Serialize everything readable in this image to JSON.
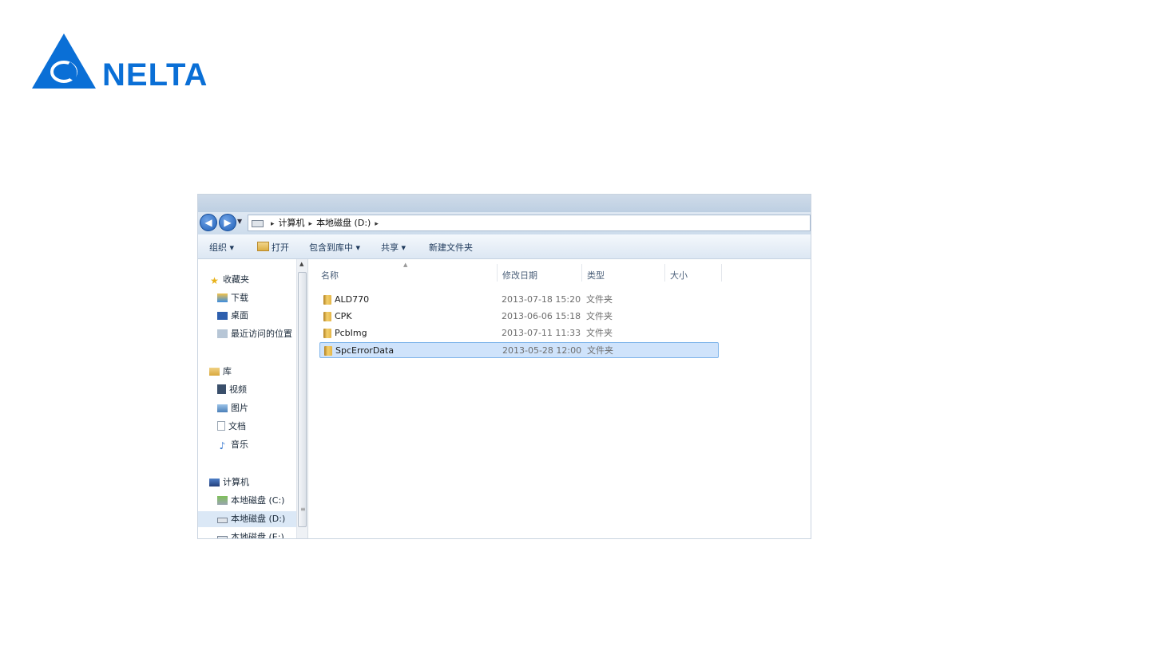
{
  "logo": {
    "text": "NELTA"
  },
  "window": {
    "breadcrumb": [
      "计算机",
      "本地磁盘 (D:)"
    ],
    "toolbar": {
      "organize": "组织 ▾",
      "open": "打开",
      "include_library": "包含到库中 ▾",
      "share": "共享 ▾",
      "new_folder": "新建文件夹"
    },
    "sidebar": {
      "favorites": "收藏夹",
      "downloads": "下载",
      "desktop": "桌面",
      "recent": "最近访问的位置",
      "libraries": "库",
      "videos": "视频",
      "pictures": "图片",
      "documents": "文档",
      "music": "音乐",
      "computer": "计算机",
      "drive_c": "本地磁盘 (C:)",
      "drive_d": "本地磁盘 (D:)",
      "drive_e": "本地磁盘 (E:)"
    },
    "columns": {
      "name": "名称",
      "date": "修改日期",
      "type": "类型",
      "size": "大小"
    },
    "files": [
      {
        "name": "ALD770",
        "date": "2013-07-18 15:20",
        "type": "文件夹",
        "selected": false
      },
      {
        "name": "CPK",
        "date": "2013-06-06 15:18",
        "type": "文件夹",
        "selected": false
      },
      {
        "name": "PcbImg",
        "date": "2013-07-11 11:33",
        "type": "文件夹",
        "selected": false
      },
      {
        "name": "SpcErrorData",
        "date": "2013-05-28 12:00",
        "type": "文件夹",
        "selected": true
      }
    ]
  }
}
